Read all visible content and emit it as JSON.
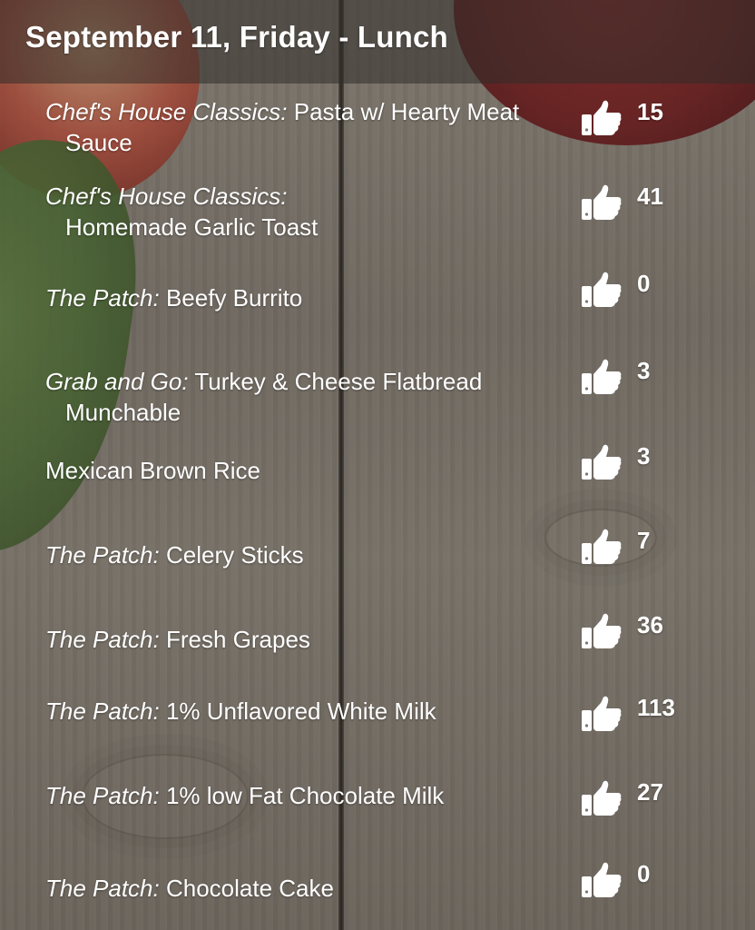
{
  "header": {
    "title": "September 11, Friday - Lunch"
  },
  "icons": {
    "like": "thumbs-up-icon"
  },
  "colors": {
    "text": "#ffffff",
    "header_bg": "rgba(50,46,42,0.55)"
  },
  "menu": {
    "items": [
      {
        "station": "Chef's House Classics:",
        "name": "Pasta w/ Hearty Meat Sauce",
        "likes": "15"
      },
      {
        "station": "Chef's House Classics:",
        "name": "Homemade Garlic Toast",
        "likes": "41"
      },
      {
        "station": "The Patch:",
        "name": "Beefy Burrito",
        "likes": "0"
      },
      {
        "station": "Grab and Go:",
        "name": "Turkey & Cheese Flatbread Munchable",
        "likes": "3"
      },
      {
        "station": "",
        "name": "Mexican Brown Rice",
        "likes": "3"
      },
      {
        "station": "The Patch:",
        "name": "Celery Sticks",
        "likes": "7"
      },
      {
        "station": "The Patch:",
        "name": "Fresh Grapes",
        "likes": "36"
      },
      {
        "station": "The Patch:",
        "name": "1% Unflavored White Milk",
        "likes": "113"
      },
      {
        "station": "The Patch:",
        "name": "1% low Fat Chocolate Milk",
        "likes": "27"
      },
      {
        "station": "The Patch:",
        "name": "Chocolate Cake",
        "likes": "0"
      }
    ]
  }
}
